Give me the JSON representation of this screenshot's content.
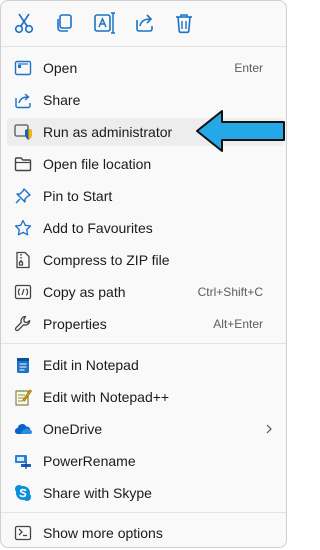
{
  "toolbar": {
    "buttons": [
      {
        "name": "cut-icon"
      },
      {
        "name": "copy-icon"
      },
      {
        "name": "rename-icon"
      },
      {
        "name": "share-icon"
      },
      {
        "name": "delete-icon"
      }
    ]
  },
  "menu": {
    "items": [
      {
        "label": "Open",
        "shortcut": "Enter",
        "icon": "open-icon"
      },
      {
        "label": "Share",
        "shortcut": "",
        "icon": "share-icon"
      },
      {
        "label": "Run as administrator",
        "shortcut": "",
        "icon": "shield-icon"
      },
      {
        "label": "Open file location",
        "shortcut": "",
        "icon": "folder-icon"
      },
      {
        "label": "Pin to Start",
        "shortcut": "",
        "icon": "pin-icon"
      },
      {
        "label": "Add to Favourites",
        "shortcut": "",
        "icon": "star-icon"
      },
      {
        "label": "Compress to ZIP file",
        "shortcut": "",
        "icon": "zip-icon"
      },
      {
        "label": "Copy as path",
        "shortcut": "Ctrl+Shift+C",
        "icon": "copy-path-icon"
      },
      {
        "label": "Properties",
        "shortcut": "Alt+Enter",
        "icon": "wrench-icon"
      },
      {
        "label": "Edit in Notepad",
        "shortcut": "",
        "icon": "notepad-icon"
      },
      {
        "label": "Edit with Notepad++",
        "shortcut": "",
        "icon": "notepadpp-icon"
      },
      {
        "label": "OneDrive",
        "shortcut": "",
        "icon": "onedrive-icon"
      },
      {
        "label": "PowerRename",
        "shortcut": "",
        "icon": "powerrename-icon"
      },
      {
        "label": "Share with Skype",
        "shortcut": "",
        "icon": "skype-icon"
      },
      {
        "label": "Show more options",
        "shortcut": "",
        "icon": "more-options-icon"
      }
    ]
  },
  "colors": {
    "accent": "#1a73c8",
    "arrow": "#25a8e8",
    "hover": "#ededed"
  }
}
